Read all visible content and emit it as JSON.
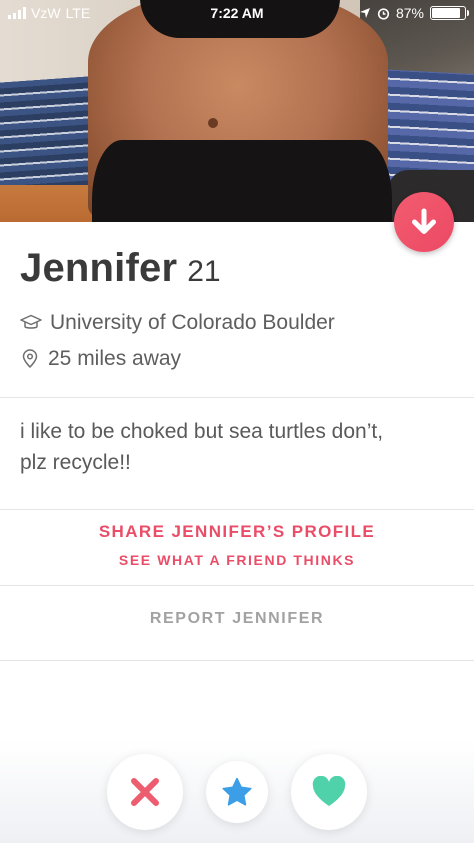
{
  "status_bar": {
    "carrier": "VzW",
    "network": "LTE",
    "time": "7:22 AM",
    "battery": "87%",
    "battery_level": 0.87
  },
  "profile": {
    "name": "Jennifer",
    "age": "21",
    "school": "University of Colorado Boulder",
    "distance": "25 miles away",
    "bio_line1": "i like to be choked but sea turtles don’t,",
    "bio_line2": "plz recycle!!"
  },
  "actions": {
    "share_label": "SHARE JENNIFER’S PROFILE",
    "share_sub_label": "SEE WHAT A FRIEND THINKS",
    "report_label": "REPORT JENNIFER"
  },
  "icons": {
    "collapse": "arrow-down-icon",
    "school": "graduation-cap-icon",
    "location": "location-pin-icon",
    "nope": "close-icon",
    "super_like": "star-icon",
    "like": "heart-icon"
  },
  "colors": {
    "accent": "#ea4d68",
    "nope": "#ec5e6f",
    "super_like": "#3d9ee8",
    "like": "#4fd1a9",
    "muted_text": "#a2a2a2"
  }
}
